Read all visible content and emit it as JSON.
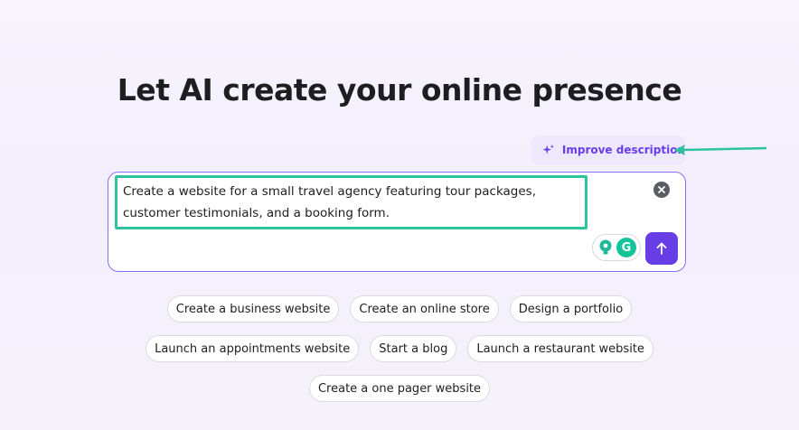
{
  "page": {
    "title": "Let AI create your online presence"
  },
  "improve": {
    "label": "Improve description"
  },
  "prompt": {
    "text": "Create a website for a small travel agency featuring tour packages, customer testimonials, and a booking form."
  },
  "icons": {
    "improve": "sparkle-icon",
    "clear": "close-circle-icon",
    "submit": "arrow-up-icon",
    "extension_1": "lightbulb-icon",
    "extension_2": "grammarly-icon",
    "annotation": "arrow-left-icon"
  },
  "extensions": {
    "grammarly_letter": "G"
  },
  "suggestions": [
    [
      "Create a business website",
      "Create an online store",
      "Design a portfolio"
    ],
    [
      "Launch an appointments website",
      "Start a blog",
      "Launch a restaurant website"
    ],
    [
      "Create a one pager website"
    ]
  ],
  "colors": {
    "accent": "#673de6",
    "highlight": "#2ec4a0",
    "grammarly": "#15c39a"
  }
}
